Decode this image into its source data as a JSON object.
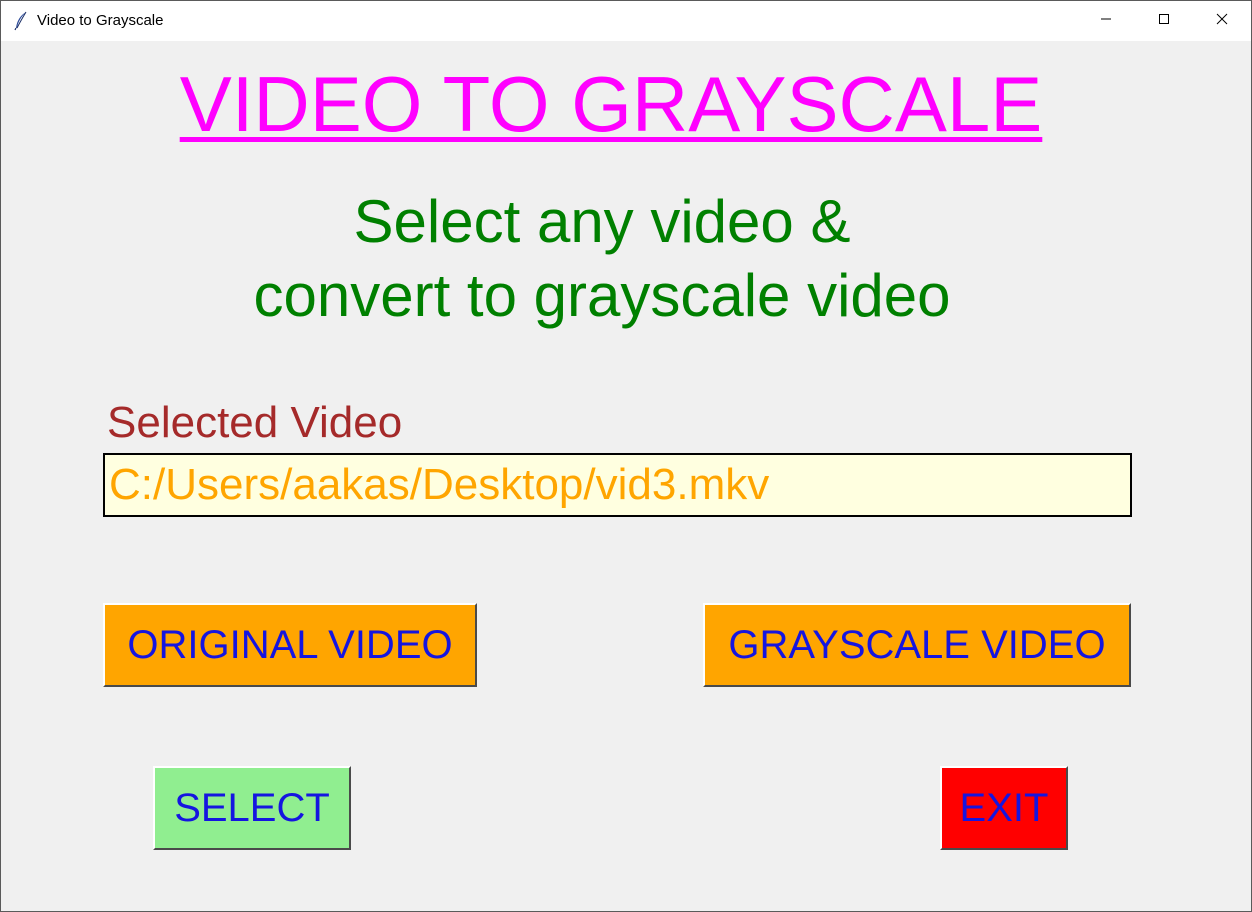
{
  "window": {
    "title": "Video to Grayscale",
    "controls": {
      "minimize_icon": "minimize-icon",
      "maximize_icon": "maximize-icon",
      "close_icon": "close-icon"
    },
    "app_icon": "feather-icon"
  },
  "main": {
    "heading": "VIDEO TO GRAYSCALE",
    "subheading_line1": "Select any video &",
    "subheading_line2": "convert to grayscale video",
    "selected_label": "Selected Video",
    "selected_path": "C:/Users/aakas/Desktop/vid3.mkv"
  },
  "buttons": {
    "original": "ORIGINAL VIDEO",
    "grayscale": "GRAYSCALE VIDEO",
    "select": "SELECT",
    "exit": "EXIT"
  },
  "colors": {
    "heading": "#ff00ff",
    "subheading": "#008000",
    "label": "#a52a2a",
    "path_text": "#ffa500",
    "path_bg": "#ffffe0",
    "button_text": "#1515e0",
    "original_bg": "#ffa500",
    "grayscale_bg": "#ffa500",
    "select_bg": "#90ee90",
    "exit_bg": "#ff0000"
  }
}
